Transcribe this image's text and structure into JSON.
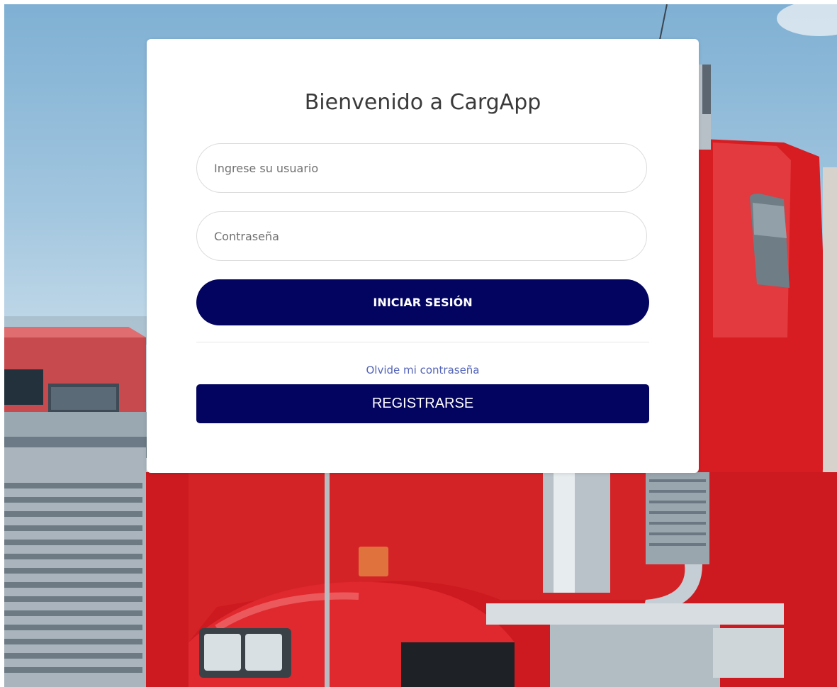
{
  "login": {
    "title": "Bienvenido a CargApp",
    "username_placeholder": "Ingrese su usuario",
    "password_placeholder": "Contraseña",
    "login_button": "INICIAR SESIÓN",
    "forgot_link": "Olvide mi contraseña",
    "register_button": "REGISTRARSE"
  },
  "colors": {
    "primary": "#030460",
    "link": "#5364b8",
    "truck_red": "#d71d22"
  }
}
